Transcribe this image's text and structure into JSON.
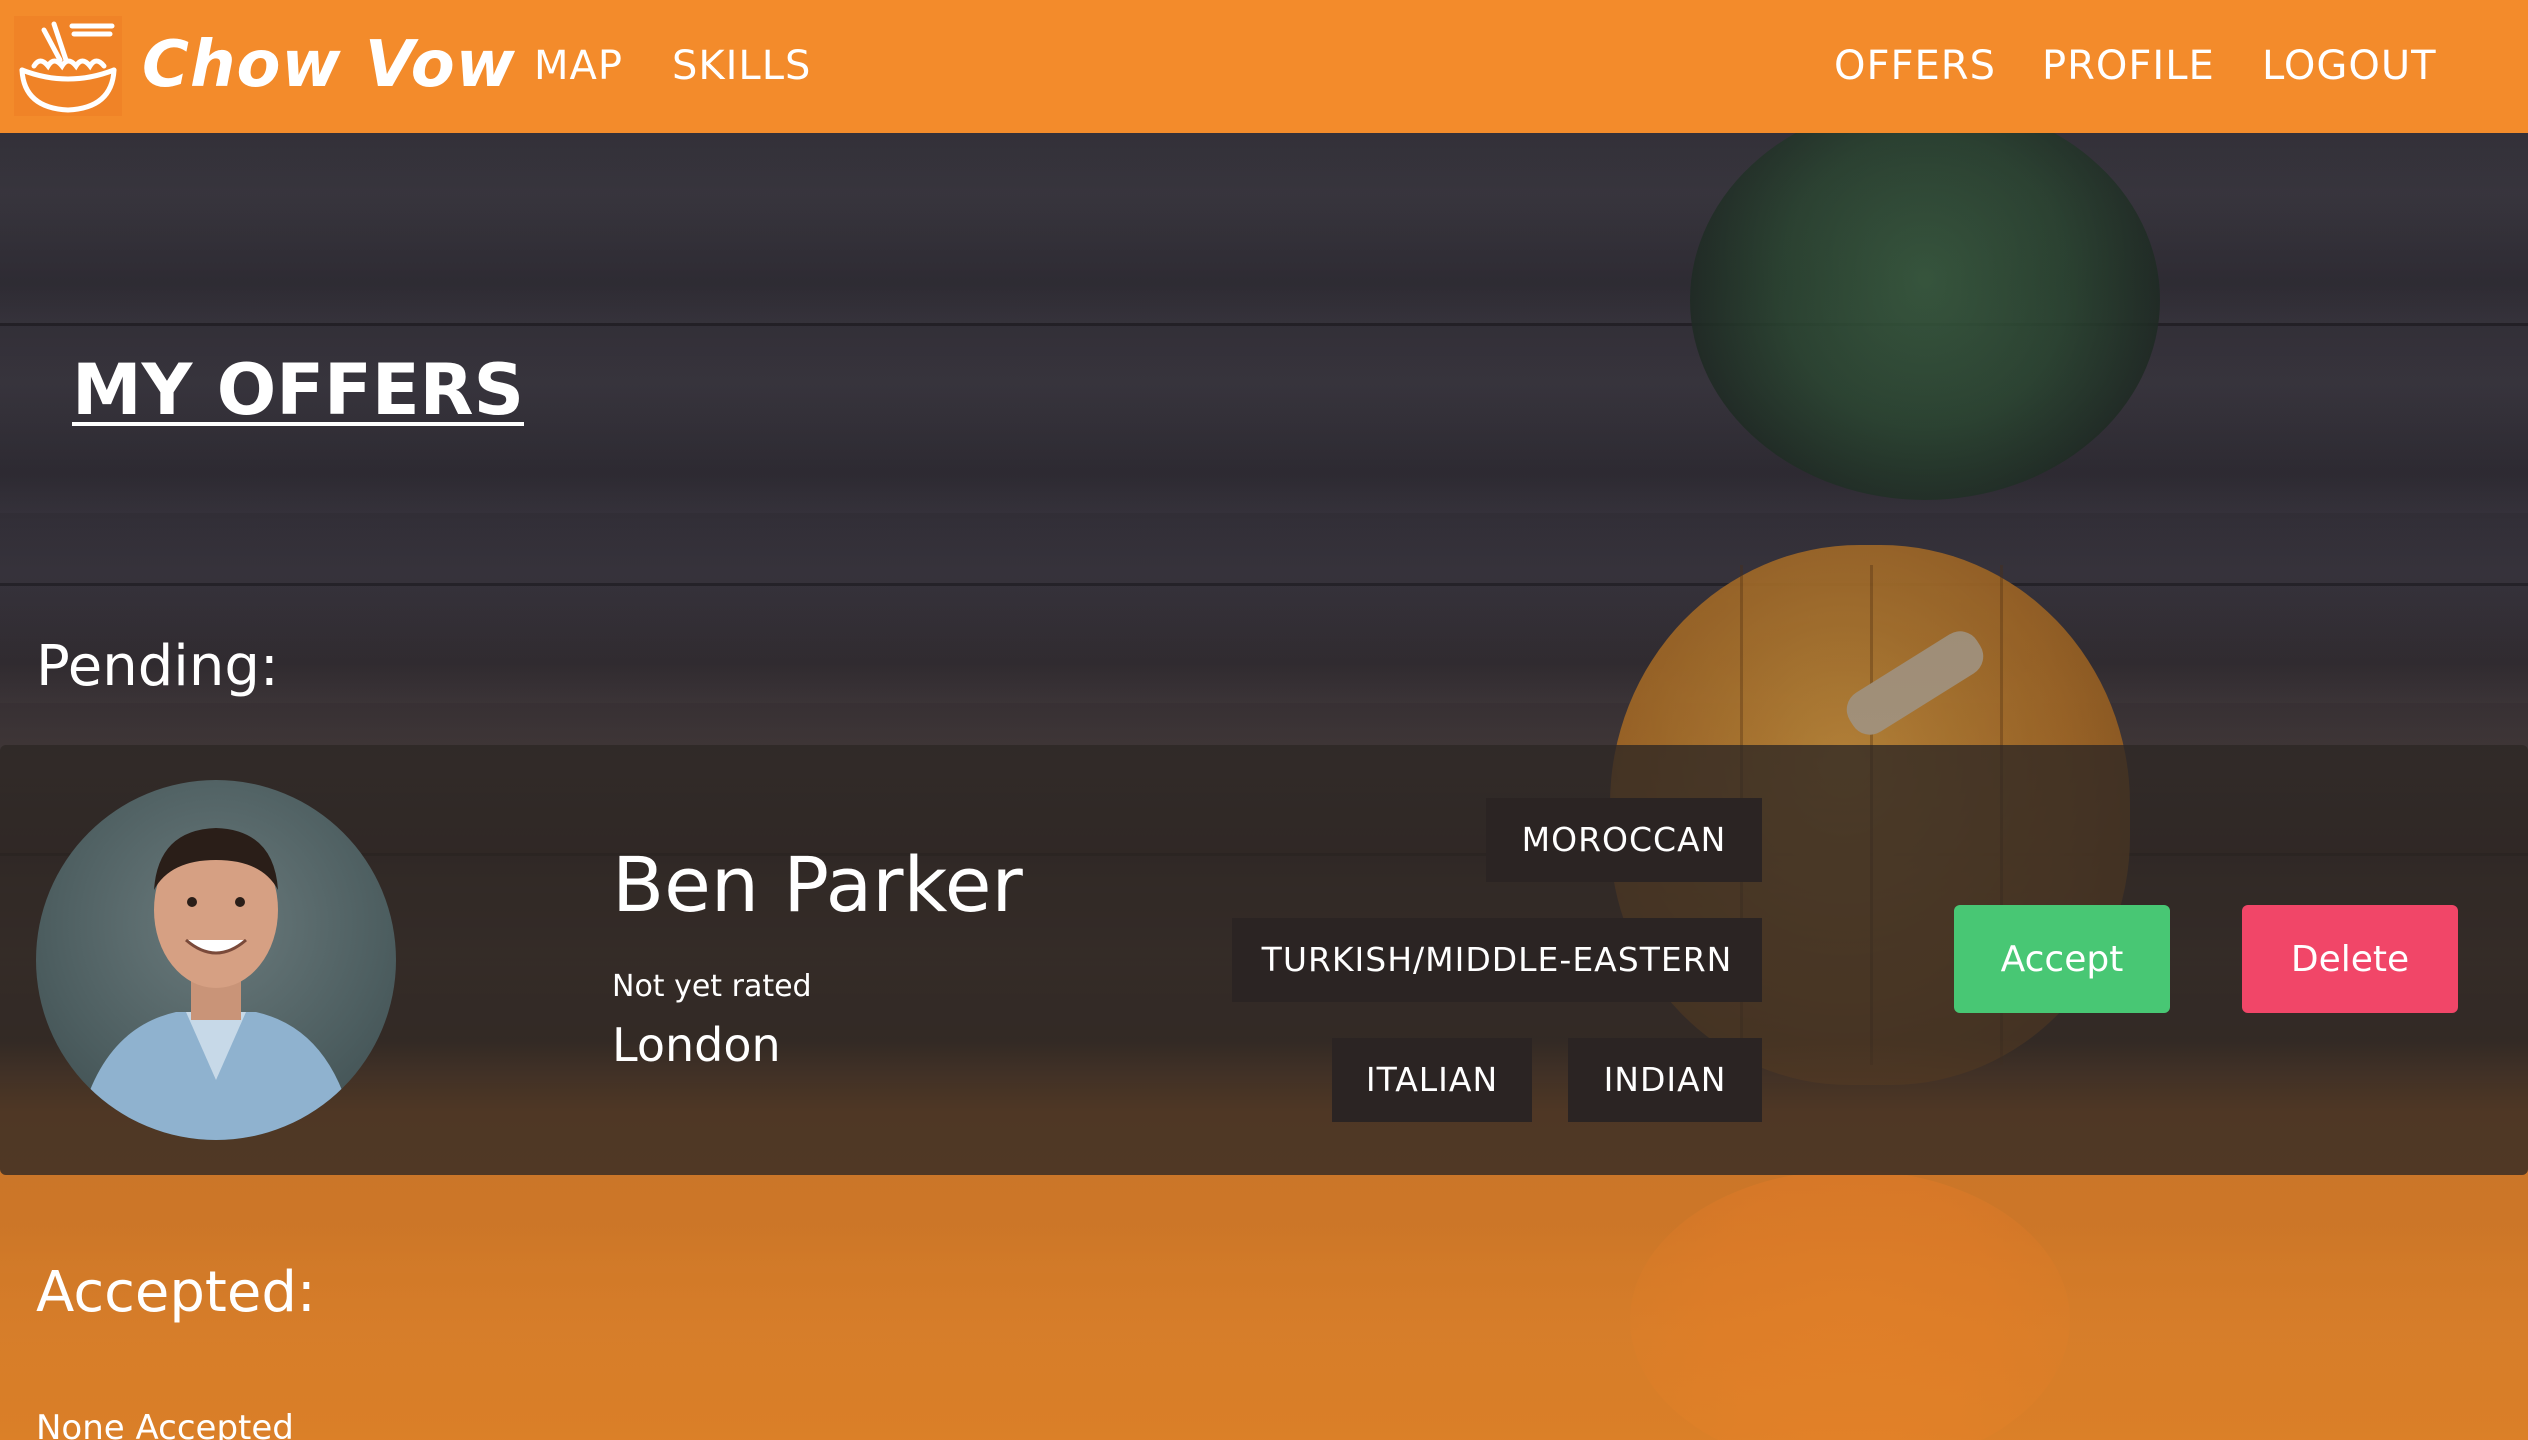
{
  "navbar": {
    "brand": "Chow Vow",
    "left_links": [
      "MAP",
      "SKILLS"
    ],
    "right_links": [
      "OFFERS",
      "PROFILE",
      "LOGOUT"
    ],
    "color": "#f38b2b"
  },
  "page": {
    "title": "MY OFFERS"
  },
  "pending": {
    "heading": "Pending:",
    "offer": {
      "name": "Ben Parker",
      "rating": "Not yet rated",
      "location": "London",
      "cuisines": [
        "MOROCCAN",
        "TURKISH/MIDDLE-EASTERN",
        "ITALIAN",
        "INDIAN"
      ],
      "accept_label": "Accept",
      "delete_label": "Delete",
      "accept_color": "#48c774",
      "delete_color": "#f14668"
    }
  },
  "accepted": {
    "heading": "Accepted:",
    "empty_text": "None Accepted"
  }
}
